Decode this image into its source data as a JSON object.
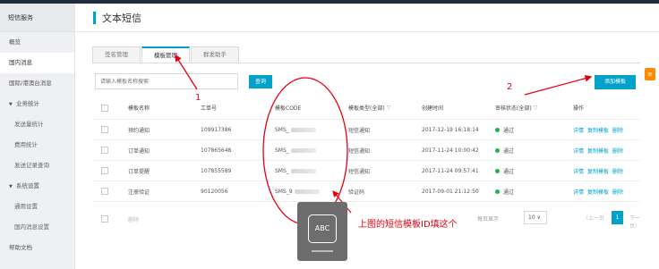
{
  "sidebar": {
    "title": "短信服务",
    "items": [
      {
        "label": "概览",
        "type": "item"
      },
      {
        "label": "国内消息",
        "type": "item",
        "active": true
      },
      {
        "label": "国际/港澳台消息",
        "type": "item"
      },
      {
        "label": "业务统计",
        "type": "group"
      },
      {
        "label": "发送量统计",
        "type": "sub"
      },
      {
        "label": "费用统计",
        "type": "sub"
      },
      {
        "label": "发送记录查询",
        "type": "sub"
      },
      {
        "label": "系统设置",
        "type": "group"
      },
      {
        "label": "通用设置",
        "type": "sub"
      },
      {
        "label": "国内消息设置",
        "type": "sub"
      },
      {
        "label": "帮助文档",
        "type": "item"
      }
    ]
  },
  "page": {
    "title": "文本短信"
  },
  "tabs": [
    "签名管理",
    "模板管理",
    "群发助手"
  ],
  "active_tab": 1,
  "search": {
    "placeholder": "请输入模板名称搜索",
    "button": "查询"
  },
  "add_button": "添加模板",
  "table": {
    "headers": [
      "模板名称",
      "工单号",
      "模板CODE",
      "模板类型(全部)",
      "创建时间",
      "审核状态(全部)",
      "操作"
    ],
    "rows": [
      {
        "name": "预约通知",
        "ticket": "109917386",
        "code": "SMS_",
        "type": "短信通知",
        "created": "2017-12-19 16:18:14",
        "status": "通过"
      },
      {
        "name": "订单通知",
        "ticket": "107865648",
        "code": "SMS_",
        "type": "短信通知",
        "created": "2017-11-24 10:00:42",
        "status": "通过"
      },
      {
        "name": "订单提醒",
        "ticket": "107855589",
        "code": "SMS_",
        "type": "短信通知",
        "created": "2017-11-24 09:57:41",
        "status": "通过"
      },
      {
        "name": "注册验证",
        "ticket": "90120056",
        "code": "SMS_9",
        "type": "验证码",
        "created": "2017-09-01 21:12:50",
        "status": "通过"
      }
    ],
    "actions": [
      "详情",
      "复制模板",
      "删除"
    ]
  },
  "footer": {
    "delete": "删除",
    "page_size_label": "每页显示",
    "page_size": "10",
    "prev": "上一页",
    "current_page": "1",
    "next": "下一页"
  },
  "annotations": {
    "num1": "1",
    "num2": "2",
    "text": "上图的短信模板ID填这个"
  },
  "ime_label": "ABC",
  "colors": {
    "accent": "#00a2ca",
    "annotation": "#e60012",
    "success": "#1ab546"
  }
}
